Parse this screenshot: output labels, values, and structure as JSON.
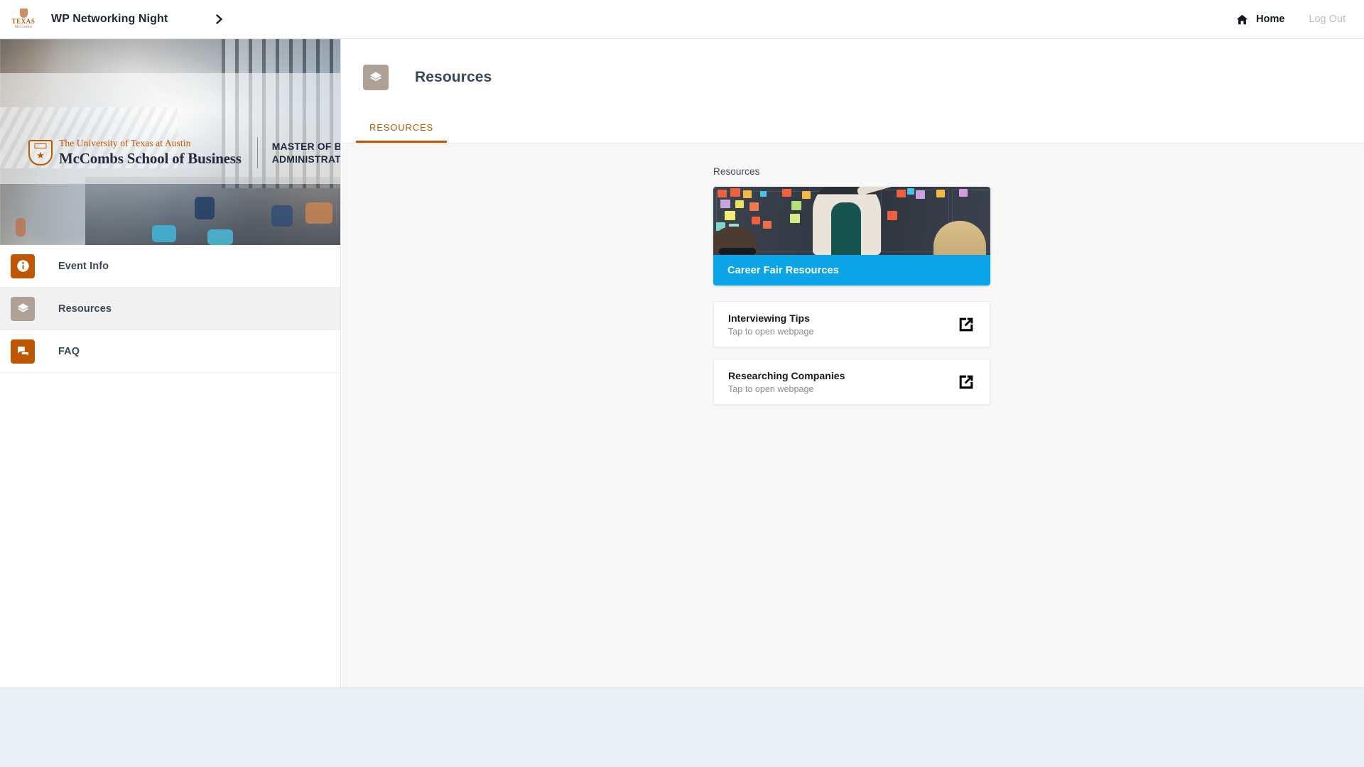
{
  "topbar": {
    "logo_name": "texas-mccombs-logo",
    "logo_texas": "TEXAS",
    "logo_sub": "McCombs",
    "event_title": "WP Networking Night",
    "breadcrumb_arrow_icon": "chevron-right-icon",
    "home_label": "Home",
    "home_icon": "home-icon",
    "logout_label": "Log Out"
  },
  "sidebar": {
    "banner": {
      "seal_icon": "ut-seal-icon",
      "university_line": "The University of Texas at Austin",
      "school_line": "McCombs School of Business",
      "program_line_1": "MASTER OF BUSINESS",
      "program_line_2": "ADMINISTRATION"
    },
    "items": [
      {
        "label": "Event Info",
        "icon": "info-icon",
        "icon_color": "#BF5700",
        "active": false
      },
      {
        "label": "Resources",
        "icon": "layers-icon",
        "icon_color": "#AFA196",
        "active": true
      },
      {
        "label": "FAQ",
        "icon": "chat-bubble-icon",
        "icon_color": "#BF5700",
        "active": false
      }
    ]
  },
  "main": {
    "page_icon": "layers-icon",
    "page_title": "Resources",
    "tabs": [
      {
        "label": "RESOURCES",
        "active": true
      }
    ],
    "section_label": "Resources",
    "hero_card": {
      "title": "Career Fair Resources",
      "banner_color": "#0BA4E8",
      "image_alt": "career-fair-photo"
    },
    "link_cards": [
      {
        "title": "Interviewing Tips",
        "subtitle": "Tap to open webpage",
        "icon": "external-link-icon"
      },
      {
        "title": "Researching Companies",
        "subtitle": "Tap to open webpage",
        "icon": "external-link-icon"
      }
    ]
  },
  "theme": {
    "accent_orange": "#BF5700",
    "accent_blue": "#0BA4E8",
    "active_taupe": "#AFA196",
    "footer_bg": "#EAEFF3"
  }
}
